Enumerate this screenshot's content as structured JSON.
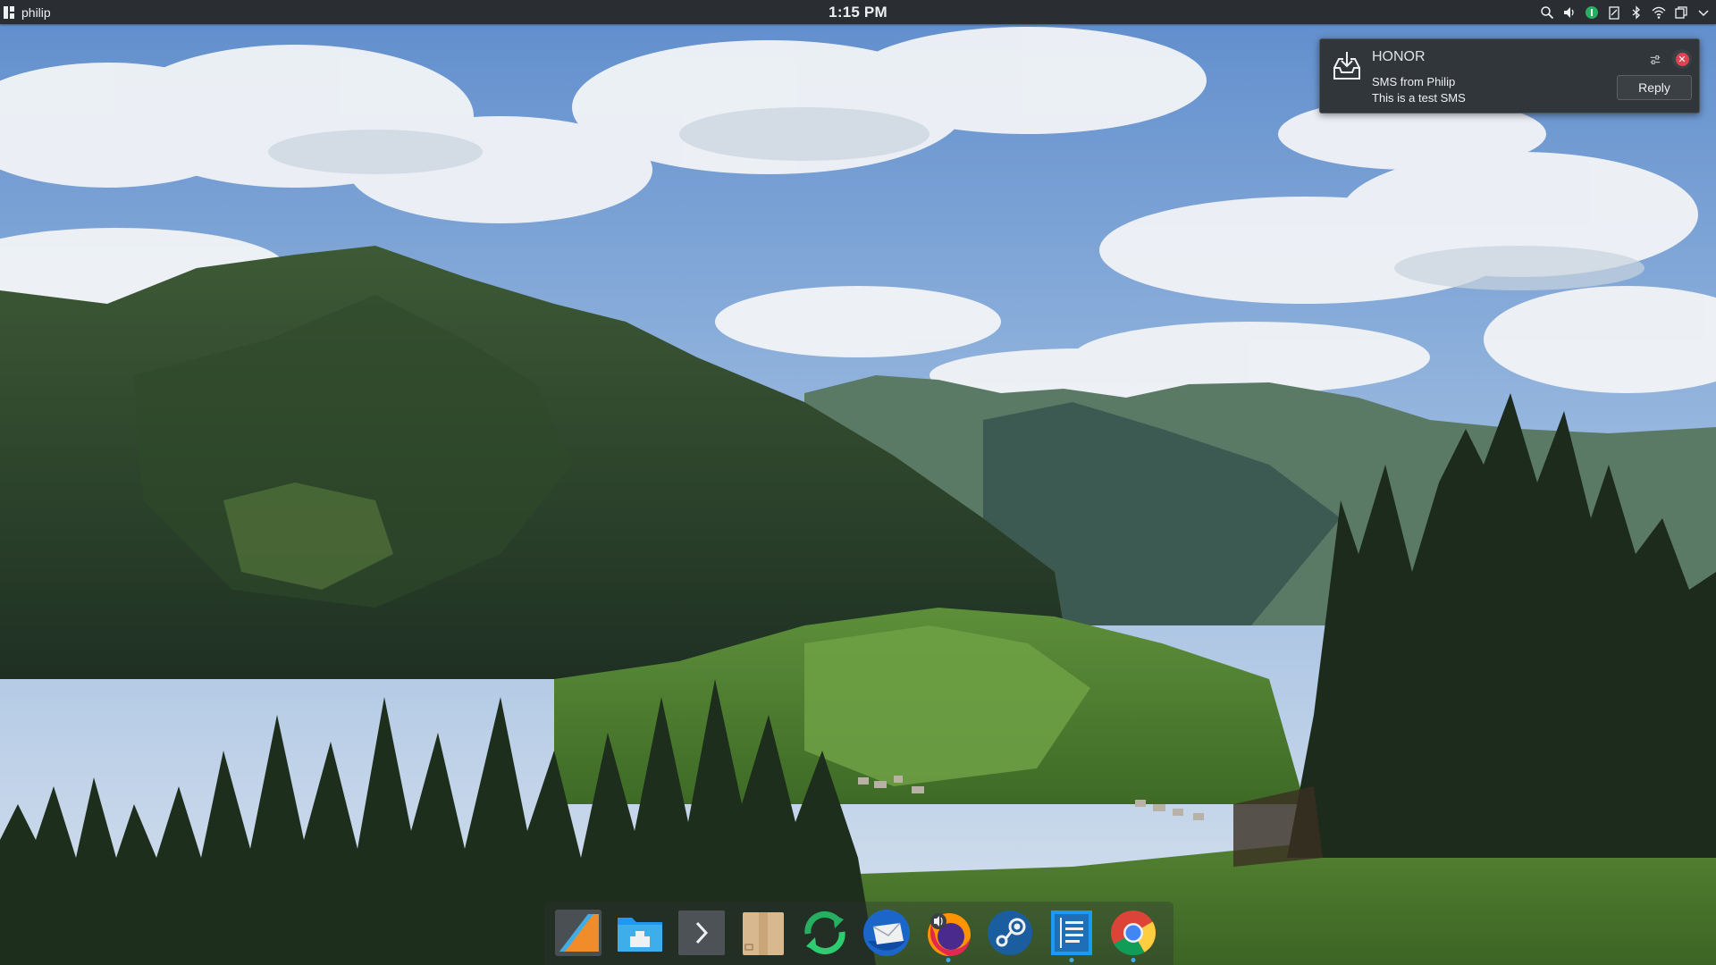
{
  "top_panel": {
    "app_menu_label": "philip",
    "clock": "1:15 PM",
    "tray_icons": [
      "search-icon",
      "volume-icon",
      "kdeconnect-icon",
      "clipboard-icon",
      "bluetooth-icon",
      "wifi-icon",
      "notifications-icon",
      "expand-tray-icon"
    ]
  },
  "notification": {
    "app_name": "HONOR",
    "summary": "SMS from Philip",
    "body": "This is a test SMS",
    "reply_label": "Reply",
    "icon": "device-inbox-icon"
  },
  "dock": {
    "items": [
      {
        "name": "text-editor-app",
        "icon": "sublime-icon",
        "running": false
      },
      {
        "name": "file-manager-app",
        "icon": "folder-icon",
        "running": false
      },
      {
        "name": "terminal-app",
        "icon": "terminal-icon",
        "running": false
      },
      {
        "name": "archive-manager-app",
        "icon": "package-icon",
        "running": false
      },
      {
        "name": "sync-app",
        "icon": "sync-icon",
        "running": false
      },
      {
        "name": "mail-app",
        "icon": "mail-icon",
        "running": false
      },
      {
        "name": "firefox-app",
        "icon": "firefox-icon",
        "running": true
      },
      {
        "name": "steam-app",
        "icon": "steam-icon",
        "running": false
      },
      {
        "name": "notes-app",
        "icon": "notes-icon",
        "running": true
      },
      {
        "name": "chrome-app",
        "icon": "chrome-icon",
        "running": true
      }
    ]
  },
  "colors": {
    "panel_bg": "#2a2e32",
    "accent": "#3daee9",
    "close_red": "#da4453"
  }
}
